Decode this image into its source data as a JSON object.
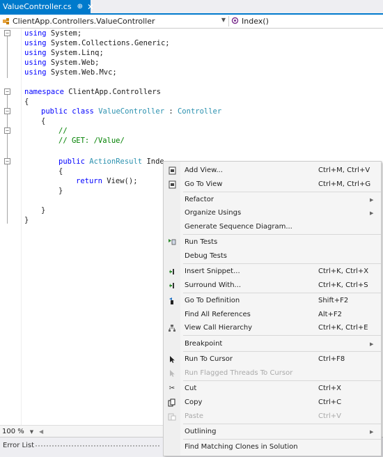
{
  "tab": {
    "title": "ValueController.cs",
    "pin": "⊕",
    "close": "✕"
  },
  "nav": {
    "left": "ClientApp.Controllers.ValueController",
    "right": "Index()"
  },
  "code": {
    "line1": "using System;",
    "line2": "using System.Collections.Generic;",
    "line3": "using System.Linq;",
    "line4": "using System.Web;",
    "line5": "using System.Web.Mvc;",
    "ns_kw": "namespace",
    "ns_name": " ClientApp.Controllers",
    "brace_open": "{",
    "class_kw": "public class ",
    "class_name": "ValueController",
    "class_sep": " : ",
    "class_base": "Controller",
    "cm1": "//",
    "cm2": "// GET: /Value/",
    "method_kw": "public ",
    "method_type": "ActionResult",
    "method_name": " Inde",
    "return_kw": "return",
    "return_rest": " View();",
    "brace_close": "}"
  },
  "status": {
    "zoom": "100 %"
  },
  "panel": {
    "title": "Error List"
  },
  "menu": {
    "add_view": {
      "label": "Add View...",
      "shortcut": "Ctrl+M, Ctrl+V"
    },
    "go_to_view": {
      "label": "Go To View",
      "shortcut": "Ctrl+M, Ctrl+G"
    },
    "refactor": {
      "label": "Refactor"
    },
    "organize_usings": {
      "label": "Organize Usings"
    },
    "gen_seq": {
      "label": "Generate Sequence Diagram..."
    },
    "run_tests": {
      "label": "Run Tests"
    },
    "debug_tests": {
      "label": "Debug Tests"
    },
    "insert_snippet": {
      "label": "Insert Snippet...",
      "shortcut": "Ctrl+K, Ctrl+X"
    },
    "surround_with": {
      "label": "Surround With...",
      "shortcut": "Ctrl+K, Ctrl+S"
    },
    "go_to_def": {
      "label": "Go To Definition",
      "shortcut": "Shift+F2"
    },
    "find_refs": {
      "label": "Find All References",
      "shortcut": "Alt+F2"
    },
    "call_hierarchy": {
      "label": "View Call Hierarchy",
      "shortcut": "Ctrl+K, Ctrl+E"
    },
    "breakpoint": {
      "label": "Breakpoint"
    },
    "run_to_cursor": {
      "label": "Run To Cursor",
      "shortcut": "Ctrl+F8"
    },
    "run_flagged": {
      "label": "Run Flagged Threads To Cursor"
    },
    "cut": {
      "label": "Cut",
      "shortcut": "Ctrl+X"
    },
    "copy": {
      "label": "Copy",
      "shortcut": "Ctrl+C"
    },
    "paste": {
      "label": "Paste",
      "shortcut": "Ctrl+V"
    },
    "outlining": {
      "label": "Outlining"
    },
    "find_clones": {
      "label": "Find Matching Clones in Solution"
    }
  },
  "colors": {
    "accent": "#007acc",
    "keyword": "#0000ff",
    "type": "#2b91af",
    "comment": "#008000"
  }
}
